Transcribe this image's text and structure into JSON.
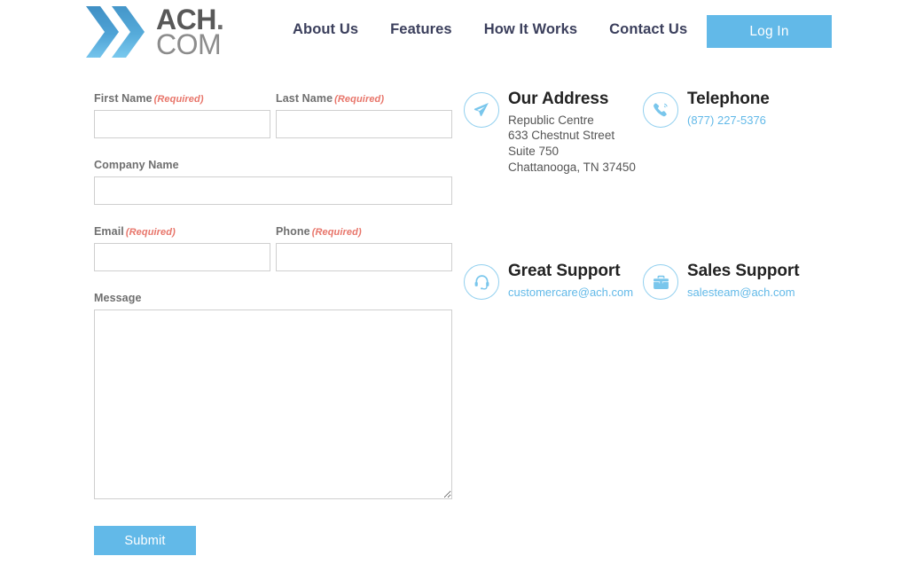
{
  "header": {
    "logo": {
      "icon": "double-chevron-logo",
      "word_top": "ACH",
      "word_top_dot": ".",
      "word_bottom": "COM",
      "chevron_color_top": "#3f8fc4",
      "chevron_color_bottom": "#69bde9"
    },
    "nav": [
      {
        "label": "About Us",
        "name": "nav-about-us"
      },
      {
        "label": "Features",
        "name": "nav-features"
      },
      {
        "label": "How It Works",
        "name": "nav-how-it-works"
      },
      {
        "label": "Contact Us",
        "name": "nav-contact-us"
      }
    ],
    "login_label": "Log In",
    "accent_color": "#62b9e8",
    "nav_text_color": "#3b3f5c"
  },
  "form": {
    "required_marker": "(Required)",
    "fields": {
      "first_name": {
        "label": "First Name",
        "required": true,
        "value": "",
        "placeholder": ""
      },
      "last_name": {
        "label": "Last Name",
        "required": true,
        "value": "",
        "placeholder": ""
      },
      "company_name": {
        "label": "Company Name",
        "required": false,
        "value": "",
        "placeholder": ""
      },
      "email": {
        "label": "Email",
        "required": true,
        "value": "",
        "placeholder": ""
      },
      "phone": {
        "label": "Phone",
        "required": true,
        "value": "",
        "placeholder": ""
      },
      "message": {
        "label": "Message",
        "required": false,
        "value": "",
        "placeholder": ""
      }
    },
    "submit_label": "Submit"
  },
  "contact_info": {
    "address": {
      "icon": "paper-plane-icon",
      "title": "Our Address",
      "line1": "Republic Centre",
      "line2": "633 Chestnut Street",
      "line3": "Suite 750",
      "line4": "Chattanooga, TN 37450"
    },
    "telephone": {
      "icon": "phone-icon",
      "title": "Telephone",
      "number": "(877) 227-5376"
    },
    "great_support": {
      "icon": "headset-icon",
      "title": "Great Support",
      "email": "customercare@ach.com"
    },
    "sales_support": {
      "icon": "briefcase-icon",
      "title": "Sales Support",
      "email": "salesteam@ach.com"
    },
    "icon_ring_color": "#92d0ef",
    "link_color": "#62b9e8"
  }
}
